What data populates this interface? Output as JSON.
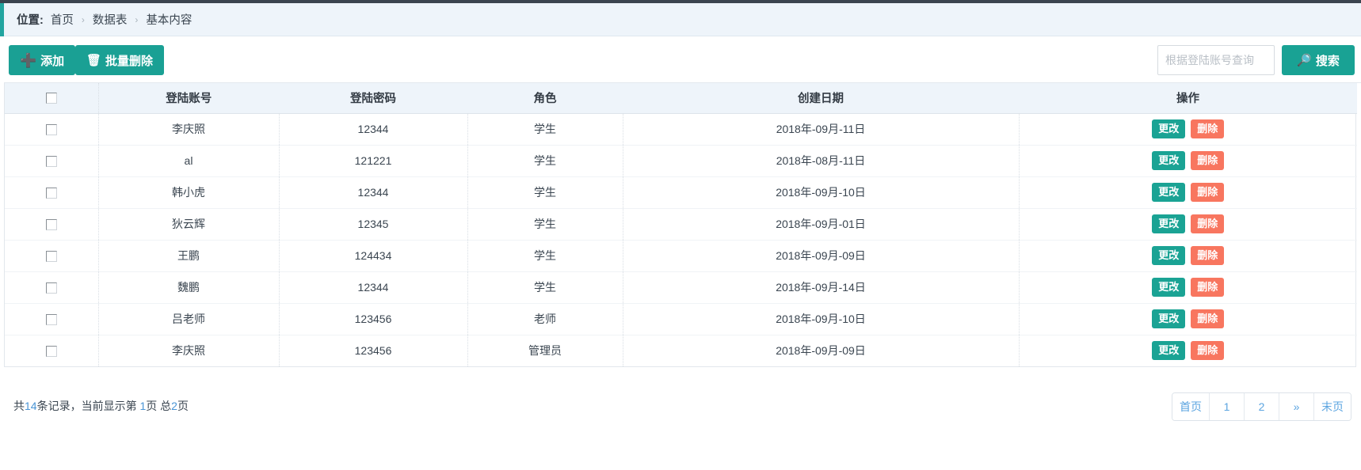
{
  "breadcrumb": {
    "label": "位置:",
    "separator": "›",
    "items": [
      "首页",
      "数据表",
      "基本内容"
    ]
  },
  "toolbar": {
    "add_label": "添加",
    "add_icon": "plus-icon",
    "bulk_delete_label": "批量删除",
    "bulk_delete_icon": "trash-icon",
    "search_placeholder": "根据登陆账号查询",
    "search_value": "",
    "search_button_label": "搜索",
    "search_icon": "magnifier-icon"
  },
  "table": {
    "columns": [
      "",
      "登陆账号",
      "登陆密码",
      "角色",
      "创建日期",
      "操作"
    ],
    "row_actions": {
      "edit_label": "更改",
      "delete_label": "删除"
    },
    "rows": [
      {
        "account": "李庆照",
        "password": "12344",
        "role": "学生",
        "created": "2018年-09月-11日"
      },
      {
        "account": "al",
        "password": "121221",
        "role": "学生",
        "created": "2018年-08月-11日"
      },
      {
        "account": "韩小虎",
        "password": "12344",
        "role": "学生",
        "created": "2018年-09月-10日"
      },
      {
        "account": "狄云辉",
        "password": "12345",
        "role": "学生",
        "created": "2018年-09月-01日"
      },
      {
        "account": "王鹏",
        "password": "124434",
        "role": "学生",
        "created": "2018年-09月-09日"
      },
      {
        "account": "魏鹏",
        "password": "12344",
        "role": "学生",
        "created": "2018年-09月-14日"
      },
      {
        "account": "吕老师",
        "password": "123456",
        "role": "老师",
        "created": "2018年-09月-10日"
      },
      {
        "account": "李庆照",
        "password": "123456",
        "role": "管理员",
        "created": "2018年-09月-09日"
      }
    ]
  },
  "footer": {
    "record_prefix": "共",
    "record_total": "14",
    "record_middle": "条记录，当前显示第",
    "current_page": "1",
    "page_unit": "页 总",
    "total_pages": "2",
    "page_suffix": "页",
    "pagination": [
      "首页",
      "1",
      "2",
      "»",
      "末页"
    ]
  },
  "colors": {
    "teal": "#1aa394",
    "orange": "#f8765f",
    "header_bg": "#eef4fa",
    "link_blue": "#5ba4e0",
    "top_strip": "#3b444f"
  }
}
